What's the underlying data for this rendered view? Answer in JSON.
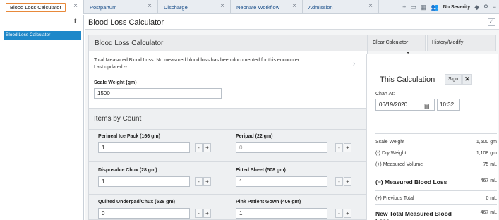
{
  "tabs": [
    {
      "label": "Blood Loss Calculator"
    },
    {
      "label": "Postpartum"
    },
    {
      "label": "Discharge"
    },
    {
      "label": "Neonate Workflow"
    },
    {
      "label": "Admission"
    }
  ],
  "tab_close": "×",
  "tabtools": {
    "add": "+",
    "severity": "No Severity",
    "search": "⚲",
    "menu": "≡"
  },
  "sidebar": {
    "pin": "⬆",
    "item": "Blood Loss Calculator"
  },
  "main": {
    "title": "Blood Loss Calculator",
    "section_title": "Blood Loss Calculator",
    "clear_label": "Clear Calculator",
    "history_label": "History/Modify",
    "total_info": "Total Measured Blood Loss: No measured blood loss has been documented for this encounter",
    "last_updated": "Last updated --",
    "scale_weight_label": "Scale Weight (gm)",
    "scale_weight_value": "1500",
    "items_title": "Items by Count",
    "items": [
      {
        "label": "Perineal Ice Pack (166 gm)",
        "value": "1",
        "placeholder": ""
      },
      {
        "label": "Peripad (22 gm)",
        "value": "",
        "placeholder": "0"
      },
      {
        "label": "Disposable Chux (28 gm)",
        "value": "1",
        "placeholder": ""
      },
      {
        "label": "Fitted Sheet (508 gm)",
        "value": "1",
        "placeholder": ""
      },
      {
        "label": "Quilted Underpad/Chux (528 gm)",
        "value": "0",
        "placeholder": ""
      },
      {
        "label": "Pink Patient Gown (406 gm)",
        "value": "1",
        "placeholder": ""
      }
    ],
    "minus": "-",
    "plus": "+"
  },
  "right": {
    "title": "This Calculation",
    "sign_label": "Sign",
    "close_label": "✕",
    "chart_at_label": "Chart At:",
    "date": "06/19/2020",
    "time": "10:32",
    "rows": [
      {
        "label": "Scale Weight",
        "value": "1,500 gm"
      },
      {
        "label": "(-) Dry Weight",
        "value": "1,108 gm"
      },
      {
        "label": "(+) Measured Volume",
        "value": "75 mL"
      }
    ],
    "measured_label": "(=) Measured Blood Loss",
    "measured_value": "467 mL",
    "previous_label": "(+) Previous Total",
    "previous_value": "0 mL",
    "new_total_label": "New Total Measured Blood Loss",
    "new_total_value": "467 mL"
  },
  "colors": {
    "accent": "#1e88c9",
    "active_tab_border": "#e8893a"
  }
}
